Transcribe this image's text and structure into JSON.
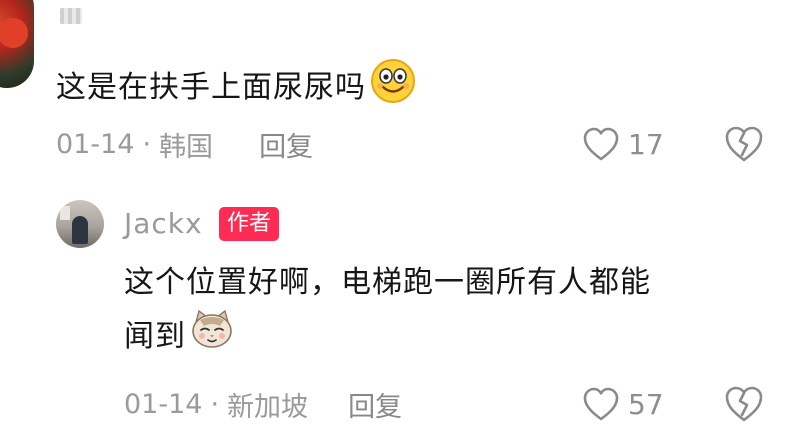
{
  "top_comment": {
    "text": "这是在扶手上面尿尿吗",
    "emoji_icon": "grinning-face-icon",
    "date": "01-14",
    "location": "韩国",
    "reply_label": "回复",
    "like_count": "17"
  },
  "reply_comment": {
    "username": "Jackx",
    "badge": "作者",
    "text_line1": "这个位置好啊，电梯跑一圈所有人都能",
    "text_line2": "闻到",
    "emoji_icon": "cat-face-icon",
    "date": "01-14",
    "location": "新加坡",
    "reply_label": "回复",
    "like_count": "57"
  },
  "colors": {
    "badge": "#fe2c55",
    "meta_text": "#9a9a9a",
    "body_text": "#161616"
  },
  "separator": "·"
}
